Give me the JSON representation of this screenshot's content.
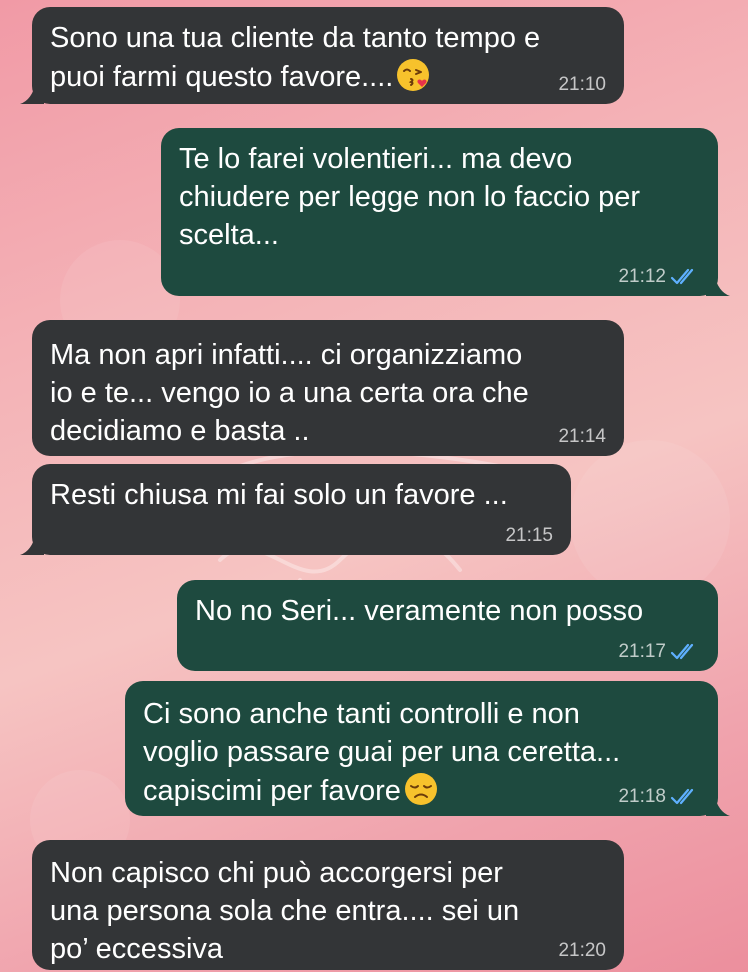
{
  "colors": {
    "incoming_bubble": "#333537",
    "outgoing_bubble": "#1e4a3f",
    "read_ticks": "#5fb0ff"
  },
  "messages": [
    {
      "direction": "incoming",
      "lines": [
        "Sono una tua cliente da tanto tempo e",
        "puoi farmi questo favore...."
      ],
      "emoji": "face-blowing-kiss-icon",
      "time": "21:10"
    },
    {
      "direction": "outgoing",
      "lines": [
        "Te lo farei volentieri... ma devo",
        "chiudere per legge non lo faccio per",
        "scelta..."
      ],
      "time": "21:12",
      "status": "read"
    },
    {
      "direction": "incoming",
      "lines": [
        "Ma non apri infatti.... ci organizziamo",
        "io e te... vengo io a una certa ora che",
        "decidiamo e basta .."
      ],
      "time": "21:14"
    },
    {
      "direction": "incoming",
      "lines": [
        "Resti chiusa mi fai solo un favore ..."
      ],
      "time": "21:15"
    },
    {
      "direction": "outgoing",
      "lines": [
        "No no Seri... veramente non posso"
      ],
      "time": "21:17",
      "status": "read"
    },
    {
      "direction": "outgoing",
      "lines": [
        "Ci sono anche tanti controlli e non",
        "voglio passare guai per una ceretta...",
        "capiscimi per favore"
      ],
      "emoji": "disappointed-face-icon",
      "time": "21:18",
      "status": "read"
    },
    {
      "direction": "incoming",
      "lines": [
        "Non capisco chi può accorgersi per",
        "una persona sola che entra.... sei un",
        "po’ eccessiva"
      ],
      "time": "21:20"
    }
  ]
}
